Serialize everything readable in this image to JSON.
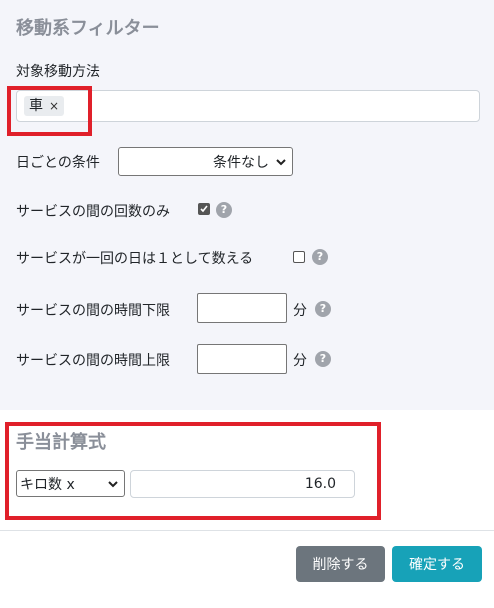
{
  "movement_filter": {
    "title": "移動系フィルター",
    "target_label": "対象移動方法",
    "tags": [
      {
        "label": "車",
        "remove": "×"
      }
    ],
    "daily_condition_label": "日ごとの条件",
    "daily_condition_value": "条件なし",
    "service_count_only_label": "サービスの間の回数のみ",
    "service_count_only_checked": true,
    "count_as_one_label": "サービスが一回の日は１として数える",
    "count_as_one_checked": false,
    "time_lower_label": "サービスの間の時間下限",
    "time_lower_unit": "分",
    "time_upper_label": "サービスの間の時間上限",
    "time_upper_unit": "分",
    "help_glyph": "?"
  },
  "allowance": {
    "title": "手当計算式",
    "formula_select_value": "キロ数 x",
    "formula_value": "16.0"
  },
  "footer": {
    "delete_label": "削除する",
    "confirm_label": "確定する"
  },
  "colors": {
    "highlight": "#e0202a",
    "delete_button": "#6c757d",
    "confirm_button": "#17a2b8",
    "panel_bg": "#f4f5fa"
  }
}
